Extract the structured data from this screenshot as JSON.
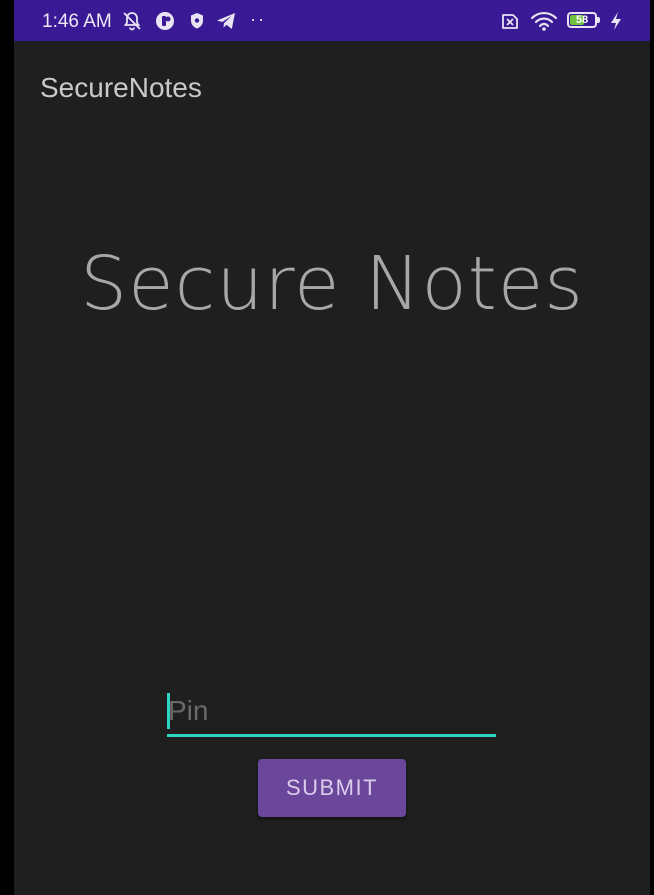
{
  "status_bar": {
    "time": "1:46 AM",
    "battery_level": "58",
    "battery_fraction": 0.58,
    "icons": [
      "notifications-off-icon",
      "app-notification-icon",
      "shield-icon",
      "telegram-icon",
      "more-dots-icon",
      "sim-disabled-icon",
      "wifi-icon",
      "battery-icon",
      "charging-icon"
    ],
    "more_dots": "··",
    "background_color": "#3a1a94",
    "battery_color": "#6fc33f"
  },
  "app_bar": {
    "title": "SecureNotes"
  },
  "main": {
    "heading": "Secure Notes",
    "pin_input": {
      "placeholder": "Pin",
      "value": ""
    },
    "submit_label": "SUBMIT"
  },
  "colors": {
    "accent": "#2fd3c2",
    "button": "#6b479c",
    "background": "#1f1f1f"
  }
}
